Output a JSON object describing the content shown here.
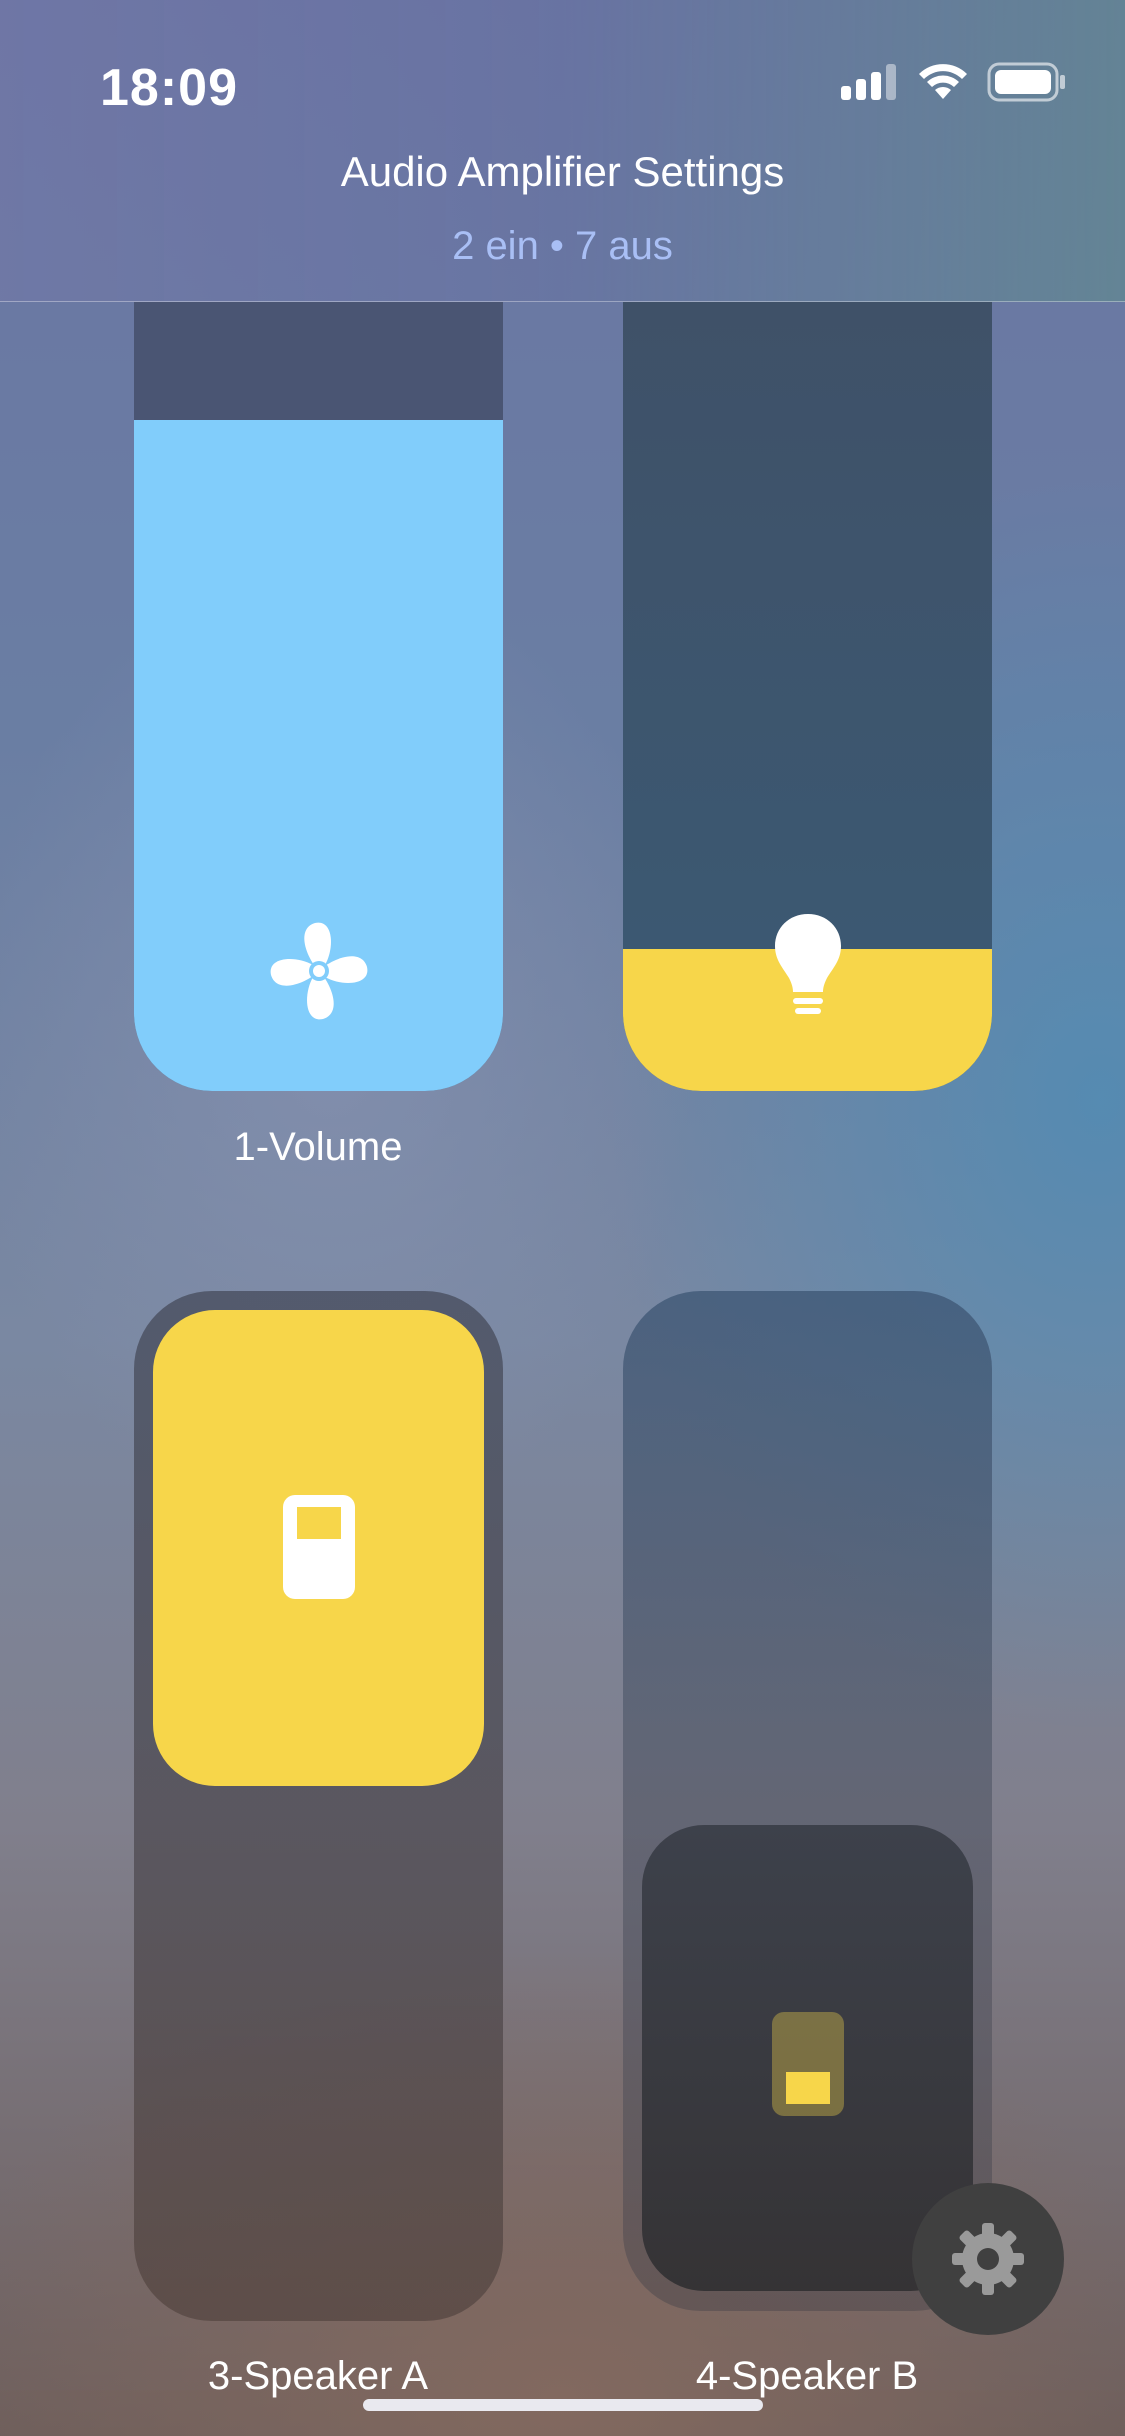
{
  "status_bar": {
    "time": "18:09"
  },
  "header": {
    "title": "Audio Amplifier Settings",
    "subtitle": "2 ein • 7 aus"
  },
  "tiles": [
    {
      "label": "1-Volume",
      "icon": "fan-icon",
      "level": 0.85,
      "color": "#81cdfb"
    },
    {
      "label": "",
      "icon": "lightbulb-icon",
      "level": 0.18,
      "color": "#f7d64a"
    },
    {
      "label": "3-Speaker A",
      "icon": "switch-icon",
      "state": "on",
      "color": "#f7d64a"
    },
    {
      "label": "4-Speaker B",
      "icon": "switch-icon",
      "state": "off"
    }
  ],
  "settings": {
    "icon": "gear-icon"
  },
  "colors": {
    "accent_yellow": "#f7d64a",
    "accent_blue": "#81cdfb",
    "subtitle": "#a9bff5"
  }
}
